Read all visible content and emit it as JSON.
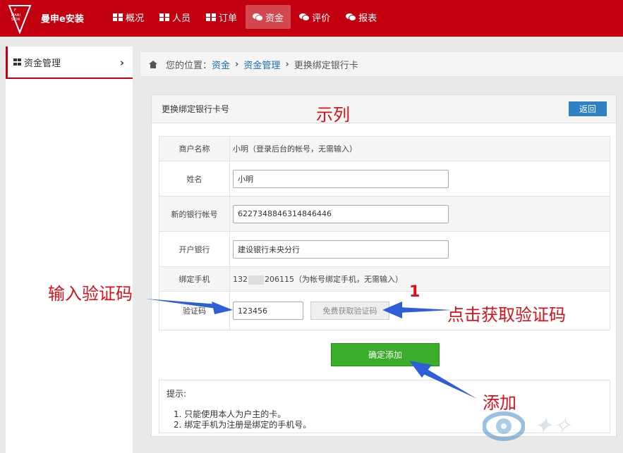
{
  "brand": "曼申e安装",
  "nav": [
    {
      "label": "概况",
      "icon": "grid-icon"
    },
    {
      "label": "人员",
      "icon": "grid-icon"
    },
    {
      "label": "订单",
      "icon": "grid-icon"
    },
    {
      "label": "资金",
      "icon": "chat-icon"
    },
    {
      "label": "评价",
      "icon": "chat-icon"
    },
    {
      "label": "报表",
      "icon": "chat-icon"
    }
  ],
  "sidebar": {
    "item": "资金管理"
  },
  "breadcrumb": {
    "prefix": "您的位置：",
    "items": [
      "资金",
      "资金管理",
      "更换绑定银行卡"
    ]
  },
  "panel": {
    "title": "更换绑定银行卡号",
    "return_label": "返回"
  },
  "form": {
    "merchant_label": "商户名称",
    "merchant_value": "小明（登录后台的帐号，无需输入）",
    "name_label": "姓名",
    "name_value": "小明",
    "account_label": "新的银行帐号",
    "account_value": "6227348846314846446",
    "bank_label": "开户银行",
    "bank_value": "建设银行未央分行",
    "phone_label": "绑定手机",
    "phone_prefix": "132",
    "phone_suffix": "206115（为帐号绑定手机，无需输入）",
    "code_label": "验证码",
    "code_value": "123456",
    "send_code_label": "免费获取验证码",
    "submit_label": "确定添加"
  },
  "tips": {
    "title": "提示:",
    "items": [
      "1. 只能使用本人为户主的卡。",
      "2. 绑定手机为注册是绑定的手机号。"
    ]
  },
  "annotations": {
    "example": "示列",
    "enter_code": "输入验证码",
    "step_number": "1",
    "click_get_code": "点击获取验证码",
    "add": "添加"
  },
  "colors": {
    "topbar": "#c3000f",
    "accent_blue": "#2f80c4",
    "submit_green": "#3aad2a",
    "annotation_red": "#d9101a",
    "arrow_blue": "#2f5fd6"
  }
}
